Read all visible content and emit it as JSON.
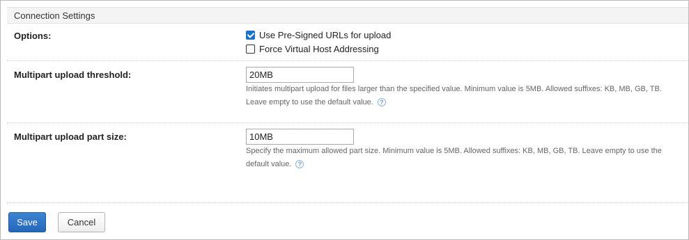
{
  "section": {
    "title": "Connection Settings"
  },
  "options": {
    "label": "Options:",
    "presigned": {
      "label": "Use Pre-Signed URLs for upload",
      "checked": true
    },
    "virtual_host": {
      "label": "Force Virtual Host Addressing",
      "checked": false
    }
  },
  "threshold": {
    "label": "Multipart upload threshold:",
    "value": "20MB",
    "hint_line1": "Initiates multipart upload for files larger than the specified value. Minimum value is 5MB. Allowed suffixes: KB, MB, GB, TB.",
    "hint_line2": "Leave empty to use the default value."
  },
  "part_size": {
    "label": "Multipart upload part size:",
    "value": "10MB",
    "hint_line1": "Specify the maximum allowed part size. Minimum value is 5MB. Allowed suffixes: KB, MB, GB, TB. Leave empty to use the",
    "hint_line2": "default value."
  },
  "help_glyph": "?",
  "buttons": {
    "save": "Save",
    "cancel": "Cancel"
  },
  "colors": {
    "primary": "#2a6fc4",
    "hint_text": "#666666",
    "help_icon": "#6f9bd0"
  },
  "icons": {
    "help": "question-circle-icon",
    "checkbox": "checkbox"
  }
}
